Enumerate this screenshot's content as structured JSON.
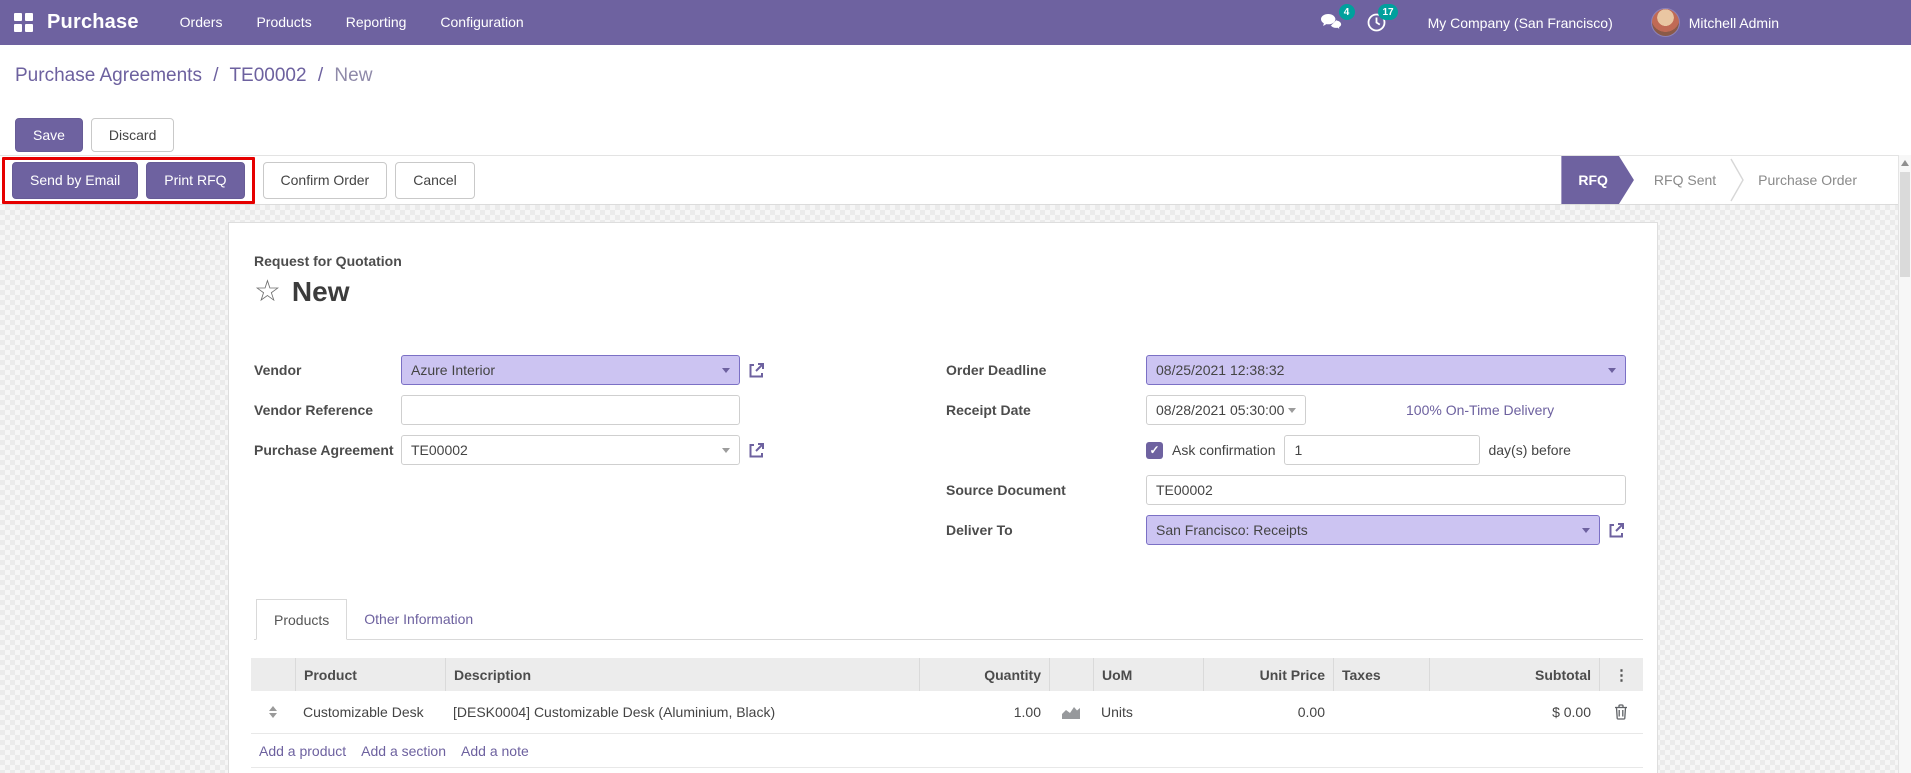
{
  "nav": {
    "app_name": "Purchase",
    "menus": [
      {
        "label": "Orders"
      },
      {
        "label": "Products"
      },
      {
        "label": "Reporting"
      },
      {
        "label": "Configuration"
      }
    ],
    "messages_badge": "4",
    "activities_badge": "17",
    "company": "My Company (San Francisco)",
    "user": "Mitchell Admin"
  },
  "breadcrumb": {
    "separator": "/",
    "items": [
      "Purchase Agreements",
      "TE00002"
    ],
    "current": "New"
  },
  "control_panel": {
    "save": "Save",
    "discard": "Discard"
  },
  "actions": {
    "send_by_email": "Send by Email",
    "print_rfq": "Print RFQ",
    "confirm_order": "Confirm Order",
    "cancel": "Cancel"
  },
  "statusbar": {
    "steps": [
      {
        "label": "RFQ",
        "active": true
      },
      {
        "label": "RFQ Sent",
        "active": false
      },
      {
        "label": "Purchase Order",
        "active": false
      }
    ]
  },
  "form": {
    "subtitle": "Request for Quotation",
    "title": "New",
    "vendor": {
      "label": "Vendor",
      "value": "Azure Interior"
    },
    "vendor_reference": {
      "label": "Vendor Reference",
      "value": ""
    },
    "purchase_agreement": {
      "label": "Purchase Agreement",
      "value": "TE00002"
    },
    "order_deadline": {
      "label": "Order Deadline",
      "value": "08/25/2021 12:38:32"
    },
    "receipt_date": {
      "label": "Receipt Date",
      "value": "08/28/2021 05:30:00",
      "on_time": "100% On-Time Delivery"
    },
    "ask_confirmation": {
      "label": "Ask confirmation",
      "value": "1",
      "suffix": "day(s) before",
      "checked": true
    },
    "source_document": {
      "label": "Source Document",
      "value": "TE00002"
    },
    "deliver_to": {
      "label": "Deliver To",
      "value": "San Francisco: Receipts"
    }
  },
  "tabs": [
    {
      "label": "Products",
      "active": true
    },
    {
      "label": "Other Information",
      "active": false
    }
  ],
  "products_table": {
    "headers": [
      "Product",
      "Description",
      "Quantity",
      "UoM",
      "Unit Price",
      "Taxes",
      "Subtotal"
    ],
    "rows": [
      {
        "product": "Customizable Desk",
        "description": "[DESK0004] Customizable Desk (Aluminium, Black)",
        "quantity": "1.00",
        "uom": "Units",
        "unit_price": "0.00",
        "taxes": "",
        "subtotal": "$ 0.00"
      }
    ],
    "footer_links": [
      "Add a product",
      "Add a section",
      "Add a note"
    ]
  },
  "icons": {
    "star": "☆",
    "check": "✓",
    "dots": "⋮"
  },
  "colors": {
    "navbar": "#6e62a0",
    "primary_button": "#6e62a0",
    "badge": "#00a09d",
    "field_highlight": "#ccc4f2",
    "annotation_red": "#e60000",
    "link": "#6d619f"
  }
}
